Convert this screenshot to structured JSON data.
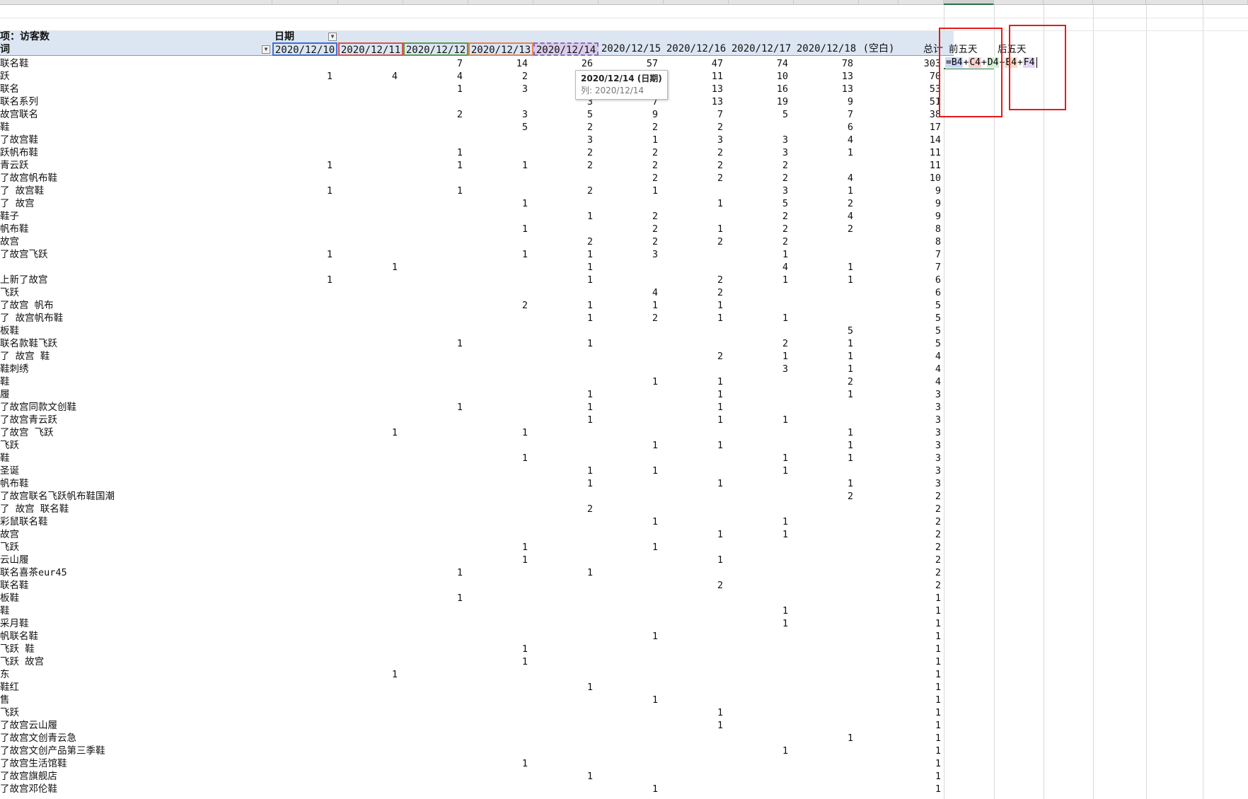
{
  "header": {
    "value_field_label": "项：访客数",
    "row_field_label": "词",
    "column_field_label": "日期",
    "total_label": "总计",
    "dates": [
      "2020/12/10",
      "2020/12/11",
      "2020/12/12",
      "2020/12/13",
      "2020/12/14",
      "2020/12/15",
      "2020/12/16",
      "2020/12/17",
      "2020/12/18",
      "(空白)"
    ],
    "first5_label": "前五天",
    "last5_label": "后五天"
  },
  "tooltip": {
    "title": "2020/12/14 (日期)",
    "subtitle": "列: 2020/12/14"
  },
  "formula": {
    "refs": [
      {
        "text": "B4",
        "color": "#cfd8f7"
      },
      {
        "text": "C4",
        "color": "#f7d0d0"
      },
      {
        "text": "D4",
        "color": "#d4efd4"
      },
      {
        "text": "E4",
        "color": "#f9dcc8"
      },
      {
        "text": "F4",
        "color": "#e4d7f2"
      }
    ],
    "part1": "=B4+C4+",
    "part2": "D4+E4+F4"
  },
  "colors": {
    "header_band": "#dce6f2",
    "sel_blue": "#3a6fd8",
    "sel_red": "#d8534f",
    "sel_green": "#5a9e4b",
    "sel_orange": "#e9825a",
    "sel_purple": "#8e6dbf",
    "red_box": "#e8191c"
  },
  "rows": [
    {
      "label": "联名鞋",
      "v": [
        "",
        "",
        "7",
        "14",
        "26",
        "57",
        "47",
        "74",
        "78",
        "",
        "303"
      ]
    },
    {
      "label": "跃",
      "v": [
        "1",
        "4",
        "4",
        "2",
        "",
        "",
        "11",
        "10",
        "13",
        "",
        "70"
      ]
    },
    {
      "label": "联名",
      "v": [
        "",
        "",
        "1",
        "3",
        "",
        "",
        "13",
        "16",
        "13",
        "",
        "53"
      ]
    },
    {
      "label": "联名系列",
      "v": [
        "",
        "",
        "",
        "",
        "3",
        "7",
        "13",
        "19",
        "9",
        "",
        "51"
      ]
    },
    {
      "label": "故宫联名",
      "v": [
        "",
        "",
        "2",
        "3",
        "5",
        "9",
        "7",
        "5",
        "7",
        "",
        "38"
      ]
    },
    {
      "label": "鞋",
      "v": [
        "",
        "",
        "",
        "5",
        "2",
        "2",
        "2",
        "",
        "6",
        "",
        "17"
      ]
    },
    {
      "label": "了故宫鞋",
      "v": [
        "",
        "",
        "",
        "",
        "3",
        "1",
        "3",
        "3",
        "4",
        "",
        "14"
      ]
    },
    {
      "label": "跃帆布鞋",
      "v": [
        "",
        "",
        "1",
        "",
        "2",
        "2",
        "2",
        "3",
        "1",
        "",
        "11"
      ]
    },
    {
      "label": "青云跃",
      "v": [
        "1",
        "",
        "1",
        "1",
        "2",
        "2",
        "2",
        "2",
        "",
        "",
        "11"
      ]
    },
    {
      "label": "了故宫帆布鞋",
      "v": [
        "",
        "",
        "",
        "",
        "",
        "2",
        "2",
        "2",
        "4",
        "",
        "10"
      ]
    },
    {
      "label": "了 故宫鞋",
      "v": [
        "1",
        "",
        "1",
        "",
        "2",
        "1",
        "",
        "3",
        "1",
        "",
        "9"
      ]
    },
    {
      "label": "了 故宫",
      "v": [
        "",
        "",
        "",
        "1",
        "",
        "",
        "1",
        "5",
        "2",
        "",
        "9"
      ]
    },
    {
      "label": "鞋子",
      "v": [
        "",
        "",
        "",
        "",
        "1",
        "2",
        "",
        "2",
        "4",
        "",
        "9"
      ]
    },
    {
      "label": "帆布鞋",
      "v": [
        "",
        "",
        "",
        "1",
        "",
        "2",
        "1",
        "2",
        "2",
        "",
        "8"
      ]
    },
    {
      "label": "故宫",
      "v": [
        "",
        "",
        "",
        "",
        "2",
        "2",
        "2",
        "2",
        "",
        "",
        "8"
      ]
    },
    {
      "label": "了故宫飞跃",
      "v": [
        "1",
        "",
        "",
        "1",
        "1",
        "3",
        "",
        "1",
        "",
        "",
        "7"
      ]
    },
    {
      "label": "",
      "v": [
        "",
        "1",
        "",
        "",
        "1",
        "",
        "",
        "4",
        "1",
        "",
        "7"
      ]
    },
    {
      "label": "上新了故宫",
      "v": [
        "1",
        "",
        "",
        "",
        "1",
        "",
        "2",
        "1",
        "1",
        "",
        "6"
      ]
    },
    {
      "label": "飞跃",
      "v": [
        "",
        "",
        "",
        "",
        "",
        "4",
        "2",
        "",
        "",
        "",
        "6"
      ]
    },
    {
      "label": "了故宫 帆布",
      "v": [
        "",
        "",
        "",
        "2",
        "1",
        "1",
        "1",
        "",
        "",
        "",
        "5"
      ]
    },
    {
      "label": "了 故宫帆布鞋",
      "v": [
        "",
        "",
        "",
        "",
        "1",
        "2",
        "1",
        "1",
        "",
        "",
        "5"
      ]
    },
    {
      "label": "板鞋",
      "v": [
        "",
        "",
        "",
        "",
        "",
        "",
        "",
        "",
        "5",
        "",
        "5"
      ]
    },
    {
      "label": "联名款鞋飞跃",
      "v": [
        "",
        "",
        "1",
        "",
        "1",
        "",
        "",
        "2",
        "1",
        "",
        "5"
      ]
    },
    {
      "label": "了 故宫 鞋",
      "v": [
        "",
        "",
        "",
        "",
        "",
        "",
        "2",
        "1",
        "1",
        "",
        "4"
      ]
    },
    {
      "label": "鞋刺绣",
      "v": [
        "",
        "",
        "",
        "",
        "",
        "",
        "",
        "3",
        "1",
        "",
        "4"
      ]
    },
    {
      "label": "鞋",
      "v": [
        "",
        "",
        "",
        "",
        "",
        "1",
        "1",
        "",
        "2",
        "",
        "4"
      ]
    },
    {
      "label": "履",
      "v": [
        "",
        "",
        "",
        "",
        "1",
        "",
        "1",
        "",
        "1",
        "",
        "3"
      ]
    },
    {
      "label": "了故宫同款文创鞋",
      "v": [
        "",
        "",
        "1",
        "",
        "1",
        "",
        "1",
        "",
        "",
        "",
        "3"
      ]
    },
    {
      "label": "了故宫青云跃",
      "v": [
        "",
        "",
        "",
        "",
        "1",
        "",
        "1",
        "1",
        "",
        "",
        "3"
      ]
    },
    {
      "label": "了故宫 飞跃",
      "v": [
        "",
        "1",
        "",
        "1",
        "",
        "",
        "",
        "",
        "1",
        "",
        "3"
      ]
    },
    {
      "label": "飞跃",
      "v": [
        "",
        "",
        "",
        "",
        "",
        "1",
        "1",
        "",
        "1",
        "",
        "3"
      ]
    },
    {
      "label": "鞋",
      "v": [
        "",
        "",
        "",
        "1",
        "",
        "",
        "",
        "1",
        "1",
        "",
        "3"
      ]
    },
    {
      "label": "圣诞",
      "v": [
        "",
        "",
        "",
        "",
        "1",
        "1",
        "",
        "1",
        "",
        "",
        "3"
      ]
    },
    {
      "label": "帆布鞋",
      "v": [
        "",
        "",
        "",
        "",
        "1",
        "",
        "1",
        "",
        "1",
        "",
        "3"
      ]
    },
    {
      "label": "了故宫联名飞跃帆布鞋国潮",
      "v": [
        "",
        "",
        "",
        "",
        "",
        "",
        "",
        "",
        "2",
        "",
        "2"
      ]
    },
    {
      "label": "了 故宫 联名鞋",
      "v": [
        "",
        "",
        "",
        "",
        "2",
        "",
        "",
        "",
        "",
        "",
        "2"
      ]
    },
    {
      "label": "彩鼠联名鞋",
      "v": [
        "",
        "",
        "",
        "",
        "",
        "1",
        "",
        "1",
        "",
        "",
        "2"
      ]
    },
    {
      "label": "故宫",
      "v": [
        "",
        "",
        "",
        "",
        "",
        "",
        "1",
        "1",
        "",
        "",
        "2"
      ]
    },
    {
      "label": "飞跃",
      "v": [
        "",
        "",
        "",
        "1",
        "",
        "1",
        "",
        "",
        "",
        "",
        "2"
      ]
    },
    {
      "label": "云山履",
      "v": [
        "",
        "",
        "",
        "1",
        "",
        "",
        "1",
        "",
        "",
        "",
        "2"
      ]
    },
    {
      "label": "联名喜茶eur45",
      "v": [
        "",
        "",
        "1",
        "",
        "1",
        "",
        "",
        "",
        "",
        "",
        "2"
      ]
    },
    {
      "label": "联名鞋",
      "v": [
        "",
        "",
        "",
        "",
        "",
        "",
        "2",
        "",
        "",
        "",
        "2"
      ]
    },
    {
      "label": "板鞋",
      "v": [
        "",
        "",
        "1",
        "",
        "",
        "",
        "",
        "",
        "",
        "",
        "1"
      ]
    },
    {
      "label": "鞋",
      "v": [
        "",
        "",
        "",
        "",
        "",
        "",
        "",
        "1",
        "",
        "",
        "1"
      ]
    },
    {
      "label": "采月鞋",
      "v": [
        "",
        "",
        "",
        "",
        "",
        "",
        "",
        "1",
        "",
        "",
        "1"
      ]
    },
    {
      "label": "帆联名鞋",
      "v": [
        "",
        "",
        "",
        "",
        "",
        "1",
        "",
        "",
        "",
        "",
        "1"
      ]
    },
    {
      "label": "飞跃 鞋",
      "v": [
        "",
        "",
        "",
        "1",
        "",
        "",
        "",
        "",
        "",
        "",
        "1"
      ]
    },
    {
      "label": "飞跃 故宫",
      "v": [
        "",
        "",
        "",
        "1",
        "",
        "",
        "",
        "",
        "",
        "",
        "1"
      ]
    },
    {
      "label": "东",
      "v": [
        "",
        "1",
        "",
        "",
        "",
        "",
        "",
        "",
        "",
        "",
        "1"
      ]
    },
    {
      "label": "鞋红",
      "v": [
        "",
        "",
        "",
        "",
        "1",
        "",
        "",
        "",
        "",
        "",
        "1"
      ]
    },
    {
      "label": "售",
      "v": [
        "",
        "",
        "",
        "",
        "",
        "1",
        "",
        "",
        "",
        "",
        "1"
      ]
    },
    {
      "label": "飞跃",
      "v": [
        "",
        "",
        "",
        "",
        "",
        "",
        "1",
        "",
        "",
        "",
        "1"
      ]
    },
    {
      "label": "了故宫云山履",
      "v": [
        "",
        "",
        "",
        "",
        "",
        "",
        "1",
        "",
        "",
        "",
        "1"
      ]
    },
    {
      "label": "了故宫文创青云急",
      "v": [
        "",
        "",
        "",
        "",
        "",
        "",
        "",
        "",
        "1",
        "",
        "1"
      ]
    },
    {
      "label": "了故宫文创产品第三季鞋",
      "v": [
        "",
        "",
        "",
        "",
        "",
        "",
        "",
        "1",
        "",
        "",
        "1"
      ]
    },
    {
      "label": "了故宫生活馆鞋",
      "v": [
        "",
        "",
        "",
        "1",
        "",
        "",
        "",
        "",
        "",
        "",
        "1"
      ]
    },
    {
      "label": "了故宫旗舰店",
      "v": [
        "",
        "",
        "",
        "",
        "1",
        "",
        "",
        "",
        "",
        "",
        "1"
      ]
    },
    {
      "label": "了故宫邓伦鞋",
      "v": [
        "",
        "",
        "",
        "",
        "",
        "1",
        "",
        "",
        "",
        "",
        "1"
      ]
    }
  ]
}
